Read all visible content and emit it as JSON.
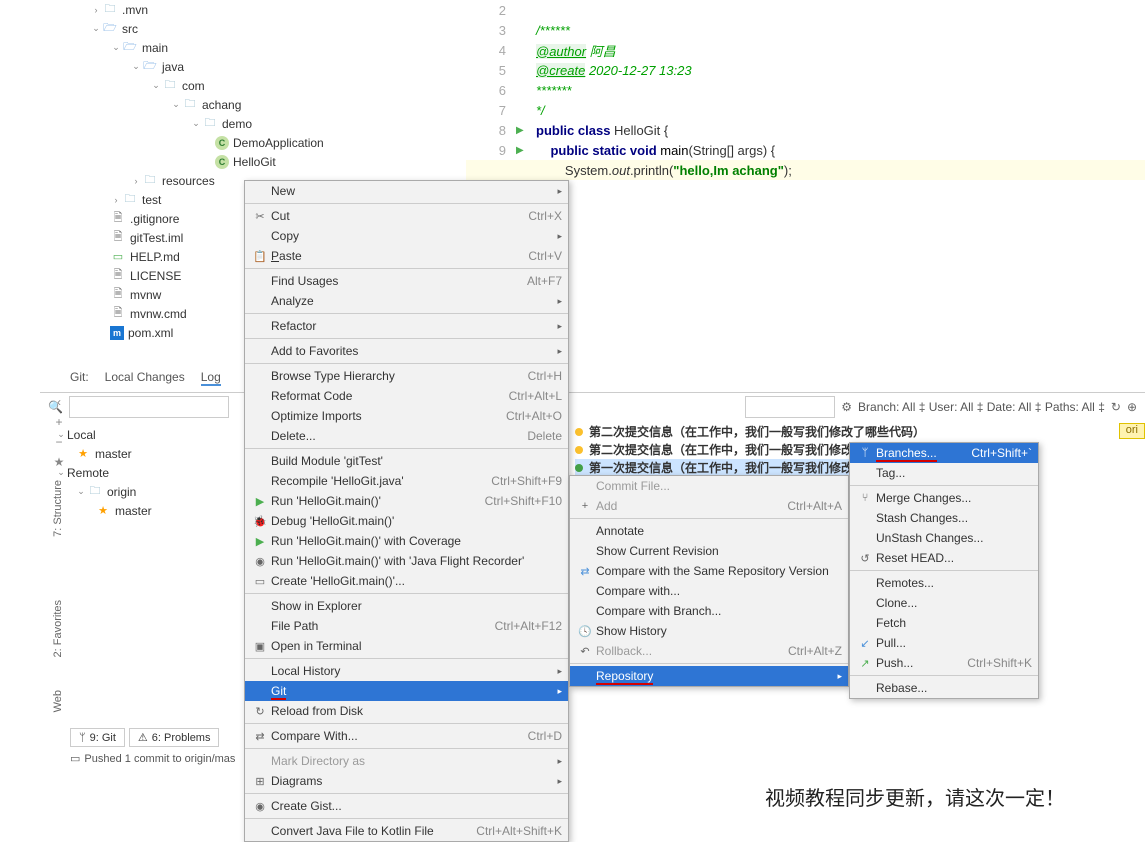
{
  "tree": {
    "mvn": ".mvn",
    "src": "src",
    "main": "main",
    "java": "java",
    "com": "com",
    "achang": "achang",
    "demo": "demo",
    "demoApp": "DemoApplication",
    "helloGit": "HelloGit",
    "resources": "resources",
    "test": "test",
    "gitignore": ".gitignore",
    "iml": "gitTest.iml",
    "help": "HELP.md",
    "license": "LICENSE",
    "mvnw": "mvnw",
    "mvnwCmd": "mvnw.cmd",
    "pom": "pom.xml"
  },
  "editor": {
    "l2": "2",
    "l3": "3",
    "l4": "4",
    "l5": "5",
    "l6": "6",
    "l7": "7",
    "l8": "8",
    "l9": "9",
    "c3": "/******",
    "c4a": "@author",
    "c4b": " 阿昌",
    "c5a": "@create",
    "c5b": " 2020-12-27 13:23",
    "c6": "*******",
    "c7": "*/",
    "c8a": "public class ",
    "c8b": "HelloGit",
    "c8c": " {",
    "c9a": "    public static void ",
    "c9b": "main",
    "c9c": "(String[] args) {",
    "c10a": "        System.",
    "c10b": "out",
    "c10c": ".println(",
    "c10d": "\"hello,Im achang\"",
    "c10e": ");"
  },
  "menu1": {
    "new": "New",
    "cut": "Cut",
    "cut_k": "Ctrl+X",
    "copy": "Copy",
    "paste": "Paste",
    "paste_k": "Ctrl+V",
    "findUsages": "Find Usages",
    "findUsages_k": "Alt+F7",
    "analyze": "Analyze",
    "refactor": "Refactor",
    "addFav": "Add to Favorites",
    "browseTH": "Browse Type Hierarchy",
    "browseTH_k": "Ctrl+H",
    "reformat": "Reformat Code",
    "reformat_k": "Ctrl+Alt+L",
    "optimize": "Optimize Imports",
    "optimize_k": "Ctrl+Alt+O",
    "delete": "Delete...",
    "delete_k": "Delete",
    "buildMod": "Build Module 'gitTest'",
    "recompile": "Recompile 'HelloGit.java'",
    "recompile_k": "Ctrl+Shift+F9",
    "run": "Run 'HelloGit.main()'",
    "run_k": "Ctrl+Shift+F10",
    "debug": "Debug 'HelloGit.main()'",
    "runCov": "Run 'HelloGit.main()' with Coverage",
    "runJfr": "Run 'HelloGit.main()' with 'Java Flight Recorder'",
    "createRun": "Create 'HelloGit.main()'...",
    "showExp": "Show in Explorer",
    "filePath": "File Path",
    "filePath_k": "Ctrl+Alt+F12",
    "openTerm": "Open in Terminal",
    "localHist": "Local History",
    "git": "Git",
    "reload": "Reload from Disk",
    "compare": "Compare With...",
    "compare_k": "Ctrl+D",
    "markDir": "Mark Directory as",
    "diagrams": "Diagrams",
    "gist": "Create Gist...",
    "convert": "Convert Java File to Kotlin File",
    "convert_k": "Ctrl+Alt+Shift+K"
  },
  "menu2": {
    "commit": "Commit File...",
    "add": "Add",
    "add_k": "Ctrl+Alt+A",
    "annotate": "Annotate",
    "showRev": "Show Current Revision",
    "cmpSame": "Compare with the Same Repository Version",
    "cmpWith": "Compare with...",
    "cmpBranch": "Compare with Branch...",
    "showHist": "Show History",
    "rollback": "Rollback...",
    "rollback_k": "Ctrl+Alt+Z",
    "repository": "Repository"
  },
  "menu3": {
    "branches": "Branches...",
    "branches_k": "Ctrl+Shift+`",
    "tag": "Tag...",
    "merge": "Merge Changes...",
    "stash": "Stash Changes...",
    "unstash": "UnStash Changes...",
    "reset": "Reset HEAD...",
    "remotes": "Remotes...",
    "clone": "Clone...",
    "fetch": "Fetch",
    "pull": "Pull...",
    "push": "Push...",
    "push_k": "Ctrl+Shift+K",
    "rebase": "Rebase..."
  },
  "git": {
    "title": "Git:",
    "tab1": "Local Changes",
    "tab2": "Log",
    "branchLbl": "Branch:",
    "all": "All",
    "userLbl": "User:",
    "dateLbl": "Date:",
    "pathsLbl": "Paths:",
    "local": "Local",
    "master": "master",
    "remote": "Remote",
    "origin": "origin",
    "originTag": "ori",
    "c1": "第二次提交信息（在工作中，我们一般写我们修改了哪些代码）",
    "c2": "第二次提交信息（在工作中，我们一般写我们修改了哪",
    "c3": "第一次提交信息（在工作中，我们一般写我们修改了哪"
  },
  "sidebar": {
    "structure": "7: Structure",
    "favorites": "2: Favorites",
    "web": "Web"
  },
  "bottom": {
    "gitTab": "9: Git",
    "problems": "6: Problems",
    "status": "Pushed 1 commit to origin/mas"
  },
  "bigText": "视频教程同步更新，请这次一定！"
}
